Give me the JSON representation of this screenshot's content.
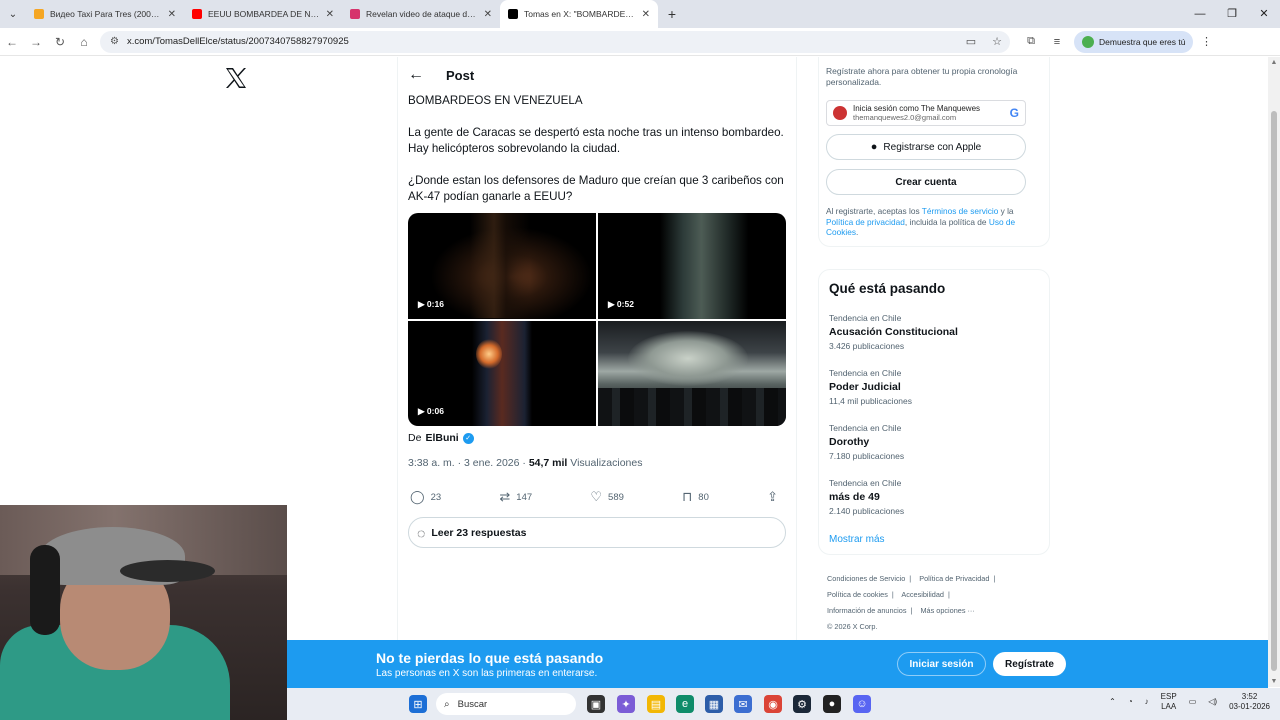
{
  "browser": {
    "tabs": [
      {
        "title": "Видео Taxi Para Tres (2001) 108",
        "favicon_color": "#f5a623",
        "active": false
      },
      {
        "title": "EEUU BOMBARDEA DE NUEVO",
        "favicon_color": "#ff0000",
        "active": false
      },
      {
        "title": "Revelan video de ataque de EE",
        "favicon_color": "#d6336c",
        "active": false
      },
      {
        "title": "Tomas en X: \"BOMBARDEOS EN",
        "favicon_color": "#000000",
        "active": true
      }
    ],
    "url": "x.com/TomasDellElce/status/2007340758827970925",
    "human_check_label": "Demuestra que eres tú"
  },
  "post": {
    "header_title": "Post",
    "paragraphs": [
      "BOMBARDEOS EN VENEZUELA",
      "La gente de Caracas se despertó esta noche tras un intenso bombardeo. Hay helicópteros sobrevolando la ciudad.",
      "¿Donde estan los defensores de Maduro que creían que 3 caribeños con AK-47 podían ganarle a EEUU?"
    ],
    "media": [
      {
        "type": "video",
        "duration": "0:16"
      },
      {
        "type": "video",
        "duration": "0:52"
      },
      {
        "type": "video",
        "duration": "0:06"
      },
      {
        "type": "image",
        "duration": ""
      }
    ],
    "source_prefix": "De",
    "source_name": "ElBuni",
    "time": "3:38 a. m. · 3 ene. 2026 ·",
    "views_count": "54,7 mil",
    "views_label": "Visualizaciones",
    "actions": {
      "replies": "23",
      "reposts": "147",
      "likes": "589",
      "bookmarks": "80"
    },
    "read_replies": "Leer 23 respuestas"
  },
  "sidebar": {
    "signup_desc": "Regístrate ahora para obtener tu propia cronología personalizada.",
    "google_name": "Inicia sesión como The Manquewes",
    "google_email": "themanquewes2.0@gmail.com",
    "apple_label": "Registrarse con Apple",
    "create_label": "Crear cuenta",
    "terms_prefix": "Al registrarte, aceptas los ",
    "terms_link": "Términos de servicio",
    "terms_mid": " y la ",
    "privacy_link": "Política de privacidad",
    "terms_mid2": ", incluida la política de ",
    "cookies_link": "Uso de Cookies",
    "terms_end": ".",
    "trends_title": "Qué está pasando",
    "trends": [
      {
        "context": "Tendencia en Chile",
        "name": "Acusación Constitucional",
        "count": "3.426 publicaciones"
      },
      {
        "context": "Tendencia en Chile",
        "name": "Poder Judicial",
        "count": "11,4 mil publicaciones"
      },
      {
        "context": "Tendencia en Chile",
        "name": "Dorothy",
        "count": "7.180 publicaciones"
      },
      {
        "context": "Tendencia en Chile",
        "name": "más de 49",
        "count": "2.140 publicaciones"
      }
    ],
    "show_more": "Mostrar más",
    "footer": {
      "terms": "Condiciones de Servicio",
      "privacy": "Política de Privacidad",
      "cookies": "Política de cookies",
      "accessibility": "Accesibilidad",
      "ads": "Información de anuncios",
      "more": "Más opciones ···",
      "copyright": "© 2026 X Corp."
    }
  },
  "banner": {
    "title": "No te pierdas lo que está pasando",
    "subtitle": "Las personas en X son las primeras en enterarse.",
    "login": "Iniciar sesión",
    "register": "Regístrate"
  },
  "taskbar": {
    "search_placeholder": "Buscar",
    "lang_top": "ESP",
    "lang_bottom": "LAA",
    "time": "3:52",
    "date": "03-01-2026"
  }
}
